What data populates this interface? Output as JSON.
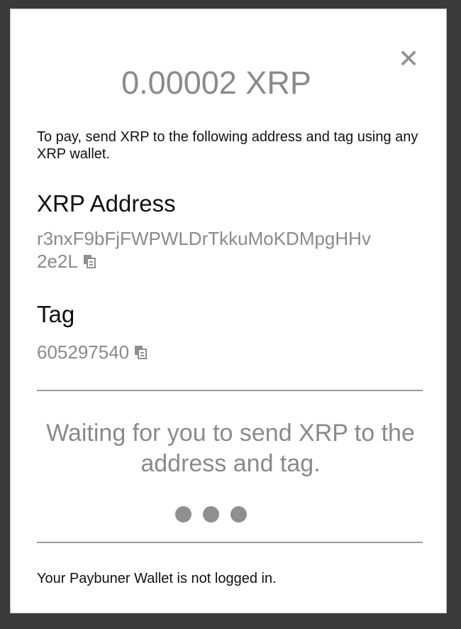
{
  "dialog": {
    "close_icon": "close-icon",
    "amount": "0.00002 XRP",
    "instructions": "To pay, send XRP to the following address and tag using any XRP wallet.",
    "address_title": "XRP Address",
    "address_line1": "r3nxF9bFjFWPWLDrTkkuMoKDMpgHHv",
    "address_line2": "2e2L",
    "tag_title": "Tag",
    "tag_value": "605297540",
    "waiting_text": "Waiting for you to send XRP to the address and tag.",
    "footer_text": "Your Paybuner Wallet is not logged in."
  },
  "colors": {
    "backdrop": "#3a3a3a",
    "muted_text": "#8a8a8a",
    "primary_text": "#111111"
  }
}
